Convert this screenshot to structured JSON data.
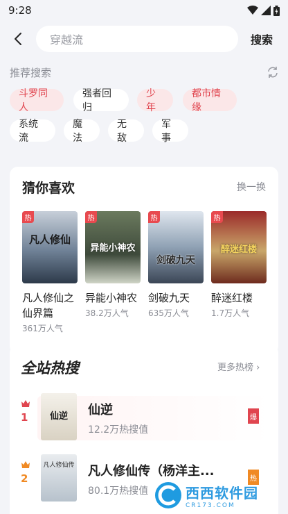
{
  "status": {
    "time": "9:28"
  },
  "search": {
    "placeholder": "穿越流",
    "button": "搜索"
  },
  "recommend": {
    "title": "推荐搜索",
    "tags": [
      {
        "label": "斗罗同人",
        "hot": true
      },
      {
        "label": "强者回归",
        "hot": false
      },
      {
        "label": "少年",
        "hot": true
      },
      {
        "label": "都市情缘",
        "hot": true
      },
      {
        "label": "系统流",
        "hot": false
      },
      {
        "label": "魔法",
        "hot": false
      },
      {
        "label": "无敌",
        "hot": false
      },
      {
        "label": "军事",
        "hot": false
      }
    ]
  },
  "guess": {
    "title": "猜你喜欢",
    "swap": "换一换",
    "hot_badge": "热",
    "books": [
      {
        "title": "凡人修仙之仙界篇",
        "popularity": "361万人气",
        "cover_text": "凡人修仙"
      },
      {
        "title": "异能小神农",
        "popularity": "38.2万人气",
        "cover_text": "异能小神农"
      },
      {
        "title": "剑破九天",
        "popularity": "635万人气",
        "cover_text": "剑破九天"
      },
      {
        "title": "醉迷红楼",
        "popularity": "1.7万人气",
        "cover_text": "醉迷红楼"
      }
    ]
  },
  "hot_search": {
    "title": "全站热搜",
    "more": "更多热榜 ›",
    "items": [
      {
        "rank": "1",
        "title": "仙逆",
        "count": "12.2万热搜值",
        "badge": "爆",
        "cover_text": "仙逆"
      },
      {
        "rank": "2",
        "title": "凡人修仙传（杨洋主...",
        "count": "80.1万热搜值",
        "badge": "热",
        "cover_text": "凡人修仙传"
      }
    ]
  },
  "watermark": {
    "text": "西西软件园",
    "sub": "CR173.COM"
  },
  "colors": {
    "accent_red": "#e0454f",
    "rank2_orange": "#f08a24",
    "bg": "#f3f4f8"
  }
}
